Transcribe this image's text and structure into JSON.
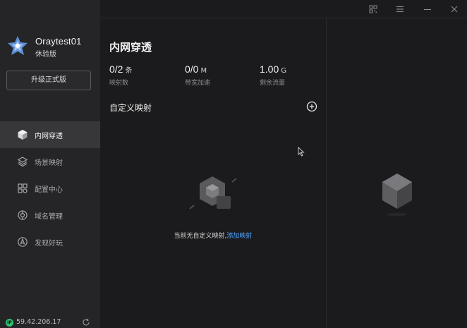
{
  "sidebar": {
    "user_name": "Oraytest01",
    "user_plan": "休验版",
    "upgrade_label": "升级正式版",
    "items": [
      {
        "label": "内网穿透",
        "icon": "cube-icon",
        "active": true
      },
      {
        "label": "场景映射",
        "icon": "layers-icon",
        "active": false
      },
      {
        "label": "配置中心",
        "icon": "grid-icon",
        "active": false
      },
      {
        "label": "域名管理",
        "icon": "globe-icon",
        "active": false
      },
      {
        "label": "发现好玩",
        "icon": "compass-icon",
        "active": false
      }
    ],
    "ip_badge": "IP",
    "ip": "59.42.206.17"
  },
  "main": {
    "title": "内网穿透",
    "stats": [
      {
        "value": "0/2",
        "unit": "条",
        "label": "映射数"
      },
      {
        "value": "0/0",
        "unit": "M",
        "label": "带宽加速"
      },
      {
        "value": "1.00",
        "unit": "G",
        "label": "剩余流量"
      }
    ],
    "section_title": "自定义映射",
    "empty_text": "当前无自定义映射,",
    "empty_link": "添加映射"
  },
  "colors": {
    "accent_link": "#4da3ff",
    "ip_badge": "#2fbf71",
    "sidebar_bg": "#252527",
    "main_bg": "#1b1b1d"
  }
}
